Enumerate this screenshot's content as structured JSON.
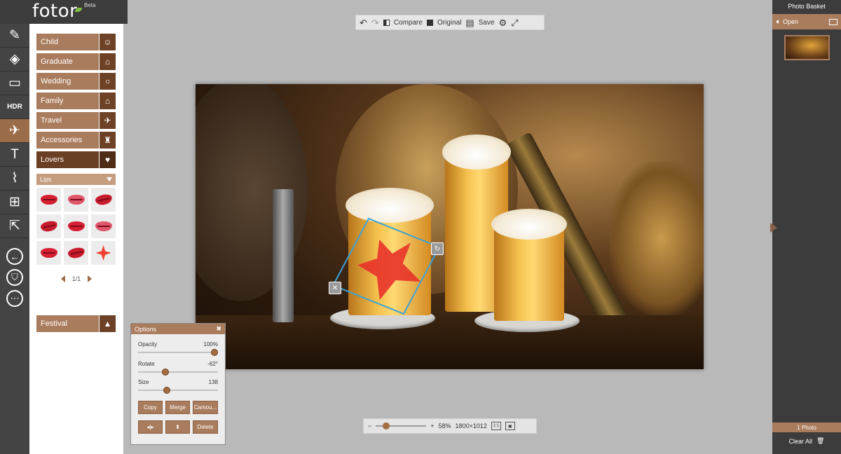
{
  "app": {
    "name": "fotor",
    "badge": "Beta"
  },
  "rail": {
    "hdr_label": "HDR"
  },
  "categories": [
    {
      "label": "Child",
      "icon": "child-icon"
    },
    {
      "label": "Graduate",
      "icon": "graduation-cap-icon"
    },
    {
      "label": "Wedding",
      "icon": "rings-icon"
    },
    {
      "label": "Family",
      "icon": "house-icon"
    },
    {
      "label": "Travel",
      "icon": "plane-icon"
    },
    {
      "label": "Accessories",
      "icon": "accessories-icon"
    },
    {
      "label": "Lovers",
      "icon": "hearts-icon",
      "active": true
    }
  ],
  "subcategory": {
    "label": "Lips"
  },
  "pager": {
    "text": "1/1"
  },
  "festival": {
    "label": "Festival",
    "icon": "tree-icon"
  },
  "toolbar": {
    "compare": "Compare",
    "original": "Original",
    "save": "Save"
  },
  "options": {
    "title": "Options",
    "opacity": {
      "label": "Opacity",
      "value": "100%",
      "level": 1.0
    },
    "rotate": {
      "label": "Rotate",
      "value": "-62°",
      "level": 0.33
    },
    "size": {
      "label": "Size",
      "value": "138",
      "level": 0.35
    },
    "buttons": {
      "copy": "Copy",
      "merge": "Merge",
      "camou": "Camou...",
      "delete": "Delete"
    }
  },
  "zoom": {
    "percent": "58%",
    "dimensions": "1800×1012"
  },
  "basket": {
    "title": "Photo Basket",
    "open": "Open",
    "count": "1 Photo",
    "clear": "Clear All"
  },
  "colors": {
    "accent": "#a97c5d",
    "accent_dark": "#6b3f24",
    "rail": "#444444",
    "selection": "#3aa3d8"
  }
}
